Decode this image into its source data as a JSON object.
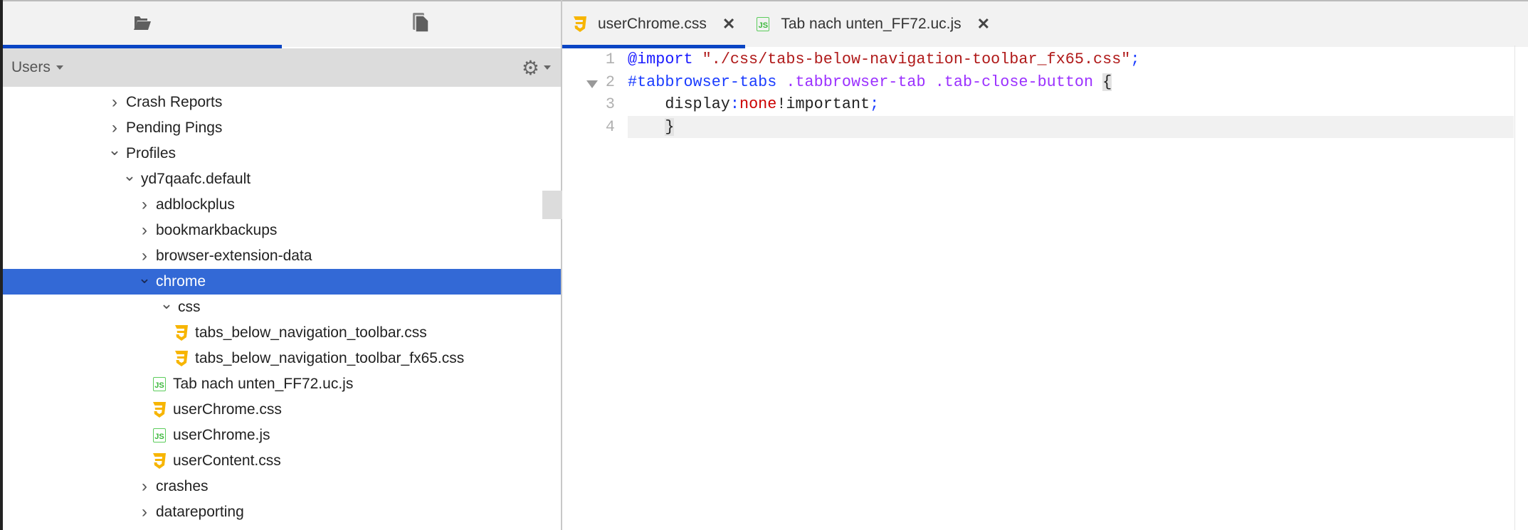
{
  "sidebar": {
    "tabs": [
      {
        "icon": "folder-open-icon",
        "active": true
      },
      {
        "icon": "documents-icon",
        "active": false
      }
    ],
    "location_label": "Users",
    "tree": [
      {
        "label": "Crash Reports",
        "level": 0,
        "type": "folder",
        "expanded": false
      },
      {
        "label": "Pending Pings",
        "level": 0,
        "type": "folder",
        "expanded": false
      },
      {
        "label": "Profiles",
        "level": 0,
        "type": "folder",
        "expanded": true
      },
      {
        "label": "yd7qaafc.default",
        "level": 1,
        "type": "folder",
        "expanded": true
      },
      {
        "label": "adblockplus",
        "level": 2,
        "type": "folder",
        "expanded": false
      },
      {
        "label": "bookmarkbackups",
        "level": 2,
        "type": "folder",
        "expanded": false
      },
      {
        "label": "browser-extension-data",
        "level": 2,
        "type": "folder",
        "expanded": false
      },
      {
        "label": "chrome",
        "level": 2,
        "type": "folder",
        "expanded": true,
        "selected": true
      },
      {
        "label": "css",
        "level": 3,
        "type": "folder",
        "expanded": true
      },
      {
        "label": "tabs_below_navigation_toolbar.css",
        "level": 4,
        "type": "css"
      },
      {
        "label": "tabs_below_navigation_toolbar_fx65.css",
        "level": 4,
        "type": "css"
      },
      {
        "label": "Tab nach unten_FF72.uc.js",
        "level": 3,
        "type": "js"
      },
      {
        "label": "userChrome.css",
        "level": 3,
        "type": "css"
      },
      {
        "label": "userChrome.js",
        "level": 3,
        "type": "js"
      },
      {
        "label": "userContent.css",
        "level": 3,
        "type": "css"
      },
      {
        "label": "crashes",
        "level": 2,
        "type": "folder",
        "expanded": false
      },
      {
        "label": "datareporting",
        "level": 2,
        "type": "folder",
        "expanded": false
      }
    ]
  },
  "editor": {
    "tabs": [
      {
        "label": "userChrome.css",
        "type": "css",
        "active": true
      },
      {
        "label": "Tab nach unten_FF72.uc.js",
        "type": "js",
        "active": false
      }
    ],
    "js_badge": "JS",
    "lines": [
      {
        "n": "1",
        "tokens": [
          [
            "kw",
            "@import"
          ],
          [
            "",
            "  "
          ],
          [
            "str",
            "\"./css/tabs-below-navigation-toolbar_fx65.css\""
          ],
          [
            "id",
            ";"
          ]
        ]
      },
      {
        "n": "2",
        "fold": true,
        "tokens": [
          [
            "id",
            "#tabbrowser-tabs"
          ],
          [
            "",
            " "
          ],
          [
            "cls",
            ".tabbrowser-tab"
          ],
          [
            "",
            " "
          ],
          [
            "cls",
            ".tab-close-button"
          ],
          [
            "",
            " "
          ],
          [
            "br",
            "{"
          ]
        ]
      },
      {
        "n": "3",
        "tokens": [
          [
            "",
            "    display"
          ],
          [
            "id",
            ":"
          ],
          [
            "val",
            "none"
          ],
          [
            "",
            "!important"
          ],
          [
            "id",
            ";"
          ]
        ]
      },
      {
        "n": "4",
        "current": true,
        "tokens": [
          [
            "",
            "    "
          ],
          [
            "br",
            "}"
          ]
        ]
      }
    ]
  },
  "colors": {
    "accent": "#0a45c4",
    "selection": "#3369d6",
    "css_icon": "#f7b500",
    "js_icon": "#5ccc5c"
  }
}
